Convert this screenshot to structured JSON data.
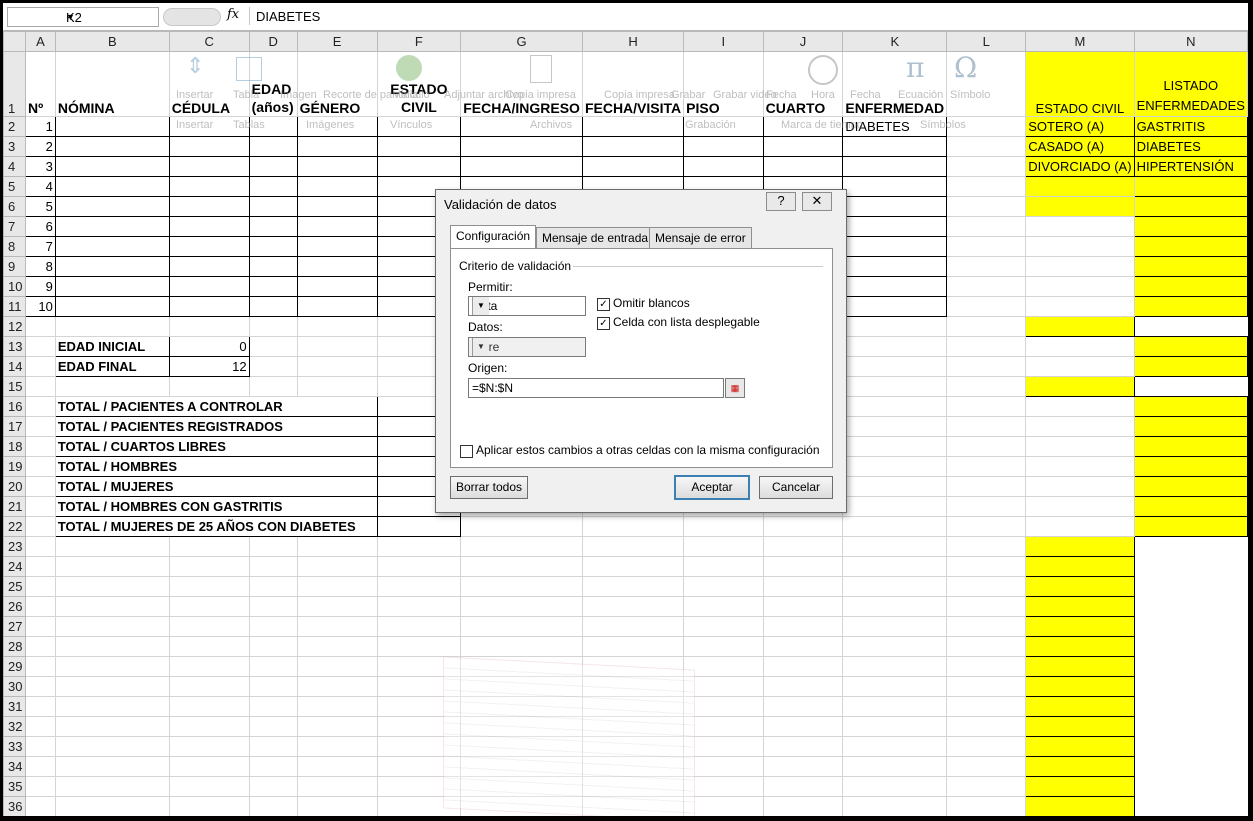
{
  "formula_bar": {
    "name_box": "K2",
    "fx": "fx",
    "content": "DIABETES"
  },
  "columns": [
    "A",
    "B",
    "C",
    "D",
    "E",
    "F",
    "G",
    "H",
    "I",
    "J",
    "K",
    "L",
    "M",
    "N"
  ],
  "header_row": {
    "a": "Nº",
    "b": "NÓMINA",
    "c": "CÉDULA",
    "d": "EDAD (años)",
    "e": "GÉNERO",
    "f": "ESTADO CIVIL",
    "g": "FECHA/INGRESO",
    "h": "FECHA/VISITA",
    "i": "PISO",
    "j": "CUARTO",
    "k": "ENFERMEDAD",
    "m": "ESTADO CIVIL",
    "n": "LISTADO ENFERMEDADES"
  },
  "row_numbers": [
    "1",
    "2",
    "3",
    "4",
    "5",
    "6",
    "7",
    "8",
    "9",
    "10",
    "11",
    "12",
    "13",
    "14",
    "15",
    "16",
    "17",
    "18",
    "19",
    "20",
    "21",
    "22",
    "23",
    "24",
    "25",
    "26",
    "27",
    "28",
    "29",
    "30",
    "31",
    "32",
    "33",
    "34",
    "35",
    "36"
  ],
  "patient_numbers": [
    "1",
    "2",
    "3",
    "4",
    "5",
    "6",
    "7",
    "8",
    "9",
    "10"
  ],
  "k2_value": "DIABETES",
  "estado_civil_list": [
    "SOTERO (A)",
    "CASADO (A)",
    "DIVORCIADO (A)"
  ],
  "enfermedades_list": [
    "GASTRITIS",
    "DIABETES",
    "HIPERTENSIÓN"
  ],
  "edad": {
    "inicial_label": "EDAD INICIAL",
    "inicial_value": "0",
    "final_label": "EDAD FINAL",
    "final_value": "12"
  },
  "totals": [
    "TOTAL / PACIENTES A CONTROLAR",
    "TOTAL / PACIENTES REGISTRADOS",
    "TOTAL / CUARTOS LIBRES",
    "TOTAL / HOMBRES",
    "TOTAL / MUJERES",
    "TOTAL / HOMBRES CON GASTRITIS",
    "TOTAL / MUJERES DE 25 AÑOS CON DIABETES"
  ],
  "ribbon_ghost": {
    "items": [
      "Insertar",
      "Tabla",
      "Imagen",
      "Recorte de pantalla",
      "Vínculo",
      "Adjuntar archivo",
      "Copia impresa",
      "Copia impresa",
      "Grabar",
      "Grabar video",
      "Fecha",
      "Hora",
      "Fecha",
      "Ecuación",
      "Símbolo"
    ],
    "groups": [
      "Insertar",
      "Tablas",
      "Imágenes",
      "Vínculos",
      "Archivos",
      "Grabación",
      "Marca de tiempo",
      "Símbolos"
    ]
  },
  "dialog": {
    "title": "Validación de datos",
    "help": "?",
    "close": "✕",
    "tabs": [
      "Configuración",
      "Mensaje de entrada",
      "Mensaje de error"
    ],
    "section": "Criterio de validación",
    "permitir_label": "Permitir:",
    "permitir_value": "Lista",
    "datos_label": "Datos:",
    "datos_value": "entre",
    "omitir_blancos": "Omitir blancos",
    "celda_lista": "Celda con lista desplegable",
    "origen_label": "Origen:",
    "origen_value": "=$N:$N",
    "aplicar": "Aplicar estos cambios a otras celdas con la misma configuración",
    "borrar": "Borrar todos",
    "aceptar": "Aceptar",
    "cancelar": "Cancelar"
  },
  "colors": {
    "highlight": "#ffff00",
    "grid_header": "#e8e8e8",
    "dialog_bg": "#f0f0f0"
  }
}
